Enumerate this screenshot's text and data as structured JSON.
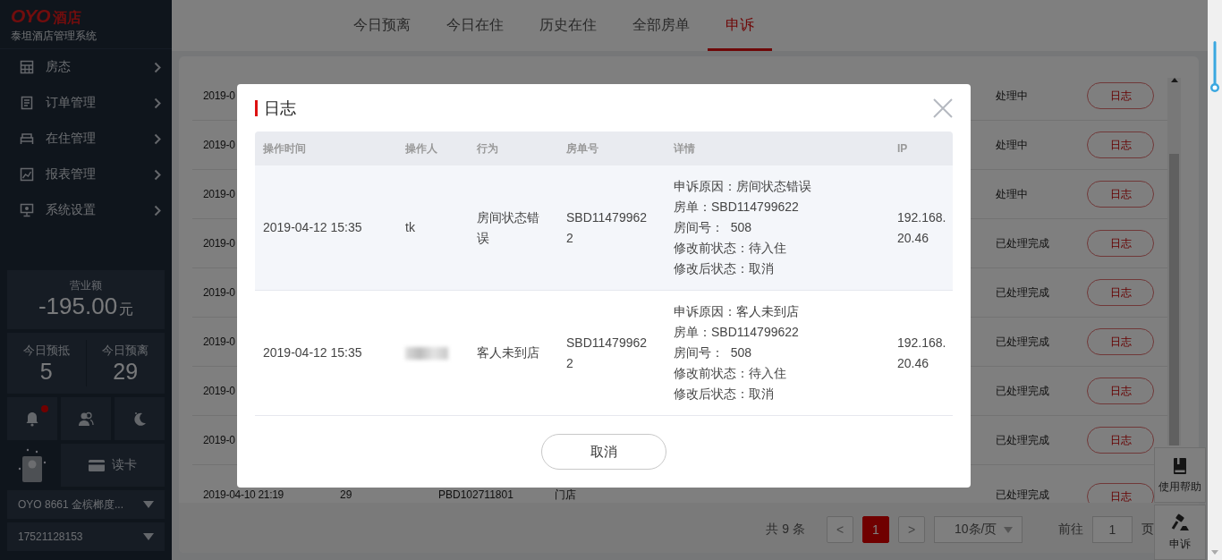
{
  "sidebar": {
    "logo": "OYO",
    "logo_suffix": "酒店",
    "system_name": "泰坦酒店管理系统",
    "menu": [
      {
        "label": "房态",
        "kind": "grid"
      },
      {
        "label": "订单管理",
        "kind": "doc"
      },
      {
        "label": "在住管理",
        "kind": "bed"
      },
      {
        "label": "报表管理",
        "kind": "chart"
      },
      {
        "label": "系统设置",
        "kind": "monitor"
      }
    ],
    "revenue": {
      "label": "营业额",
      "amount": "-195.00",
      "unit": "元"
    },
    "stats": [
      {
        "label": "今日预抵",
        "value": "5"
      },
      {
        "label": "今日预离",
        "value": "29"
      }
    ],
    "quick_actions": [
      {
        "kind": "bell",
        "badge": true
      },
      {
        "kind": "users",
        "badge": false
      },
      {
        "kind": "moon",
        "badge": false
      }
    ],
    "card_reader": {
      "label": "读卡"
    },
    "selects": [
      {
        "value": "OYO 8661 金槟榔度..."
      },
      {
        "value": "17521128153"
      }
    ]
  },
  "tabs": [
    {
      "label": "今日预离",
      "selected": false
    },
    {
      "label": "今日在住",
      "selected": false
    },
    {
      "label": "历史在住",
      "selected": false
    },
    {
      "label": "全部房单",
      "selected": false
    },
    {
      "label": "申诉",
      "selected": true
    }
  ],
  "table": {
    "rows": [
      {
        "column_1": "2019-0",
        "status": "处理中",
        "action": "日志"
      },
      {
        "column_1": "2019-0",
        "status": "处理中",
        "action": "日志"
      },
      {
        "column_1": "2019-0",
        "status": "处理中",
        "action": "日志"
      },
      {
        "column_1": "2019-0",
        "status": "已处理完成",
        "action": "日志"
      },
      {
        "column_1": "2019-0",
        "status": "已处理完成",
        "action": "日志"
      },
      {
        "column_1": "2019-0",
        "status": "已处理完成",
        "action": "日志"
      },
      {
        "column_1": "2019-0",
        "status": "已处理完成",
        "action": "日志"
      },
      {
        "column_1": "2019-0",
        "status": "已处理完成",
        "action": "日志"
      },
      {
        "column_1": "2019-04-10 21:19",
        "column_2": "29",
        "column_3": "PBD102711801",
        "column_4": "门店",
        "status": "已处理完成",
        "action": "日志"
      }
    ]
  },
  "pagination": {
    "total": "共 9 条",
    "prev": "<",
    "pages": [
      {
        "label": "1",
        "selected": true
      }
    ],
    "next": ">",
    "page_size": "10条/页",
    "goto_label": "前往",
    "goto_value": "1",
    "goto_suffix": "页"
  },
  "help_dock": [
    {
      "label": "使用帮助",
      "kind": "book"
    },
    {
      "label": "申诉",
      "kind": "gavel"
    }
  ],
  "dialog": {
    "title": "日志",
    "columns": [
      "操作时间",
      "操作人",
      "行为",
      "房单号",
      "详情",
      "IP"
    ],
    "rows": [
      {
        "time": "2019-04-12 15:35",
        "operator": "tk",
        "operator_blurred": false,
        "action": "房间状态错误",
        "order_no": "SBD114799622",
        "details": [
          "申诉原因：房间状态错误",
          "房单：SBD114799622",
          "房间号：  508",
          "修改前状态：待入住",
          "修改后状态：取消"
        ],
        "ip": "192.168.20.46"
      },
      {
        "time": "2019-04-12 15:35",
        "operator_blurred": true,
        "action": "客人未到店",
        "order_no": "SBD114799622",
        "details": [
          "申诉原因：客人未到店",
          "房单：SBD114799622",
          "房间号：  508",
          "修改前状态：待入住",
          "修改后状态：取消"
        ],
        "ip": "192.168.20.46"
      }
    ],
    "cancel": "取消"
  }
}
